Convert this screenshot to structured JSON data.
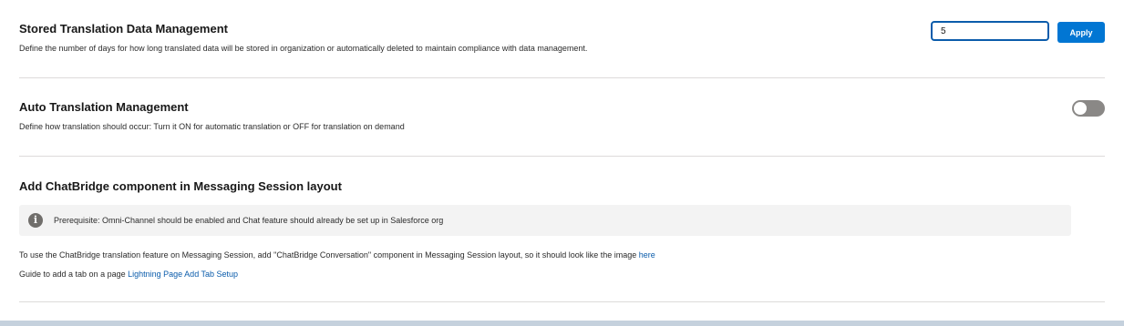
{
  "stored_translation": {
    "title": "Stored Translation Data Management",
    "description": "Define the number of days for how long translated data will be stored in organization or automatically deleted to maintain compliance with data management.",
    "days_value": "5",
    "apply_label": "Apply"
  },
  "auto_translation": {
    "title": "Auto Translation Management",
    "description": "Define how translation should occur: Turn it ON for automatic translation or OFF for translation on demand",
    "toggle_state": "off"
  },
  "chatbridge": {
    "title": "Add ChatBridge component in Messaging Session layout",
    "prerequisite_icon": "info-icon",
    "prerequisite": "Prerequisite: Omni-Channel should be enabled and Chat feature should already be set up in Salesforce org",
    "instruction": "To use the ChatBridge translation feature on Messaging Session, add \"ChatBridge Conversation\" component in Messaging Session layout, so it should look like the image",
    "instruction_link": "here",
    "guide_text": "Guide to add a tab on a page",
    "guide_link": "Lightning Page Add Tab Setup"
  },
  "colors": {
    "accent": "#0176d3",
    "link": "#0b5cab",
    "toggle_off": "#8a8886",
    "callout_bg": "#f3f3f3"
  }
}
